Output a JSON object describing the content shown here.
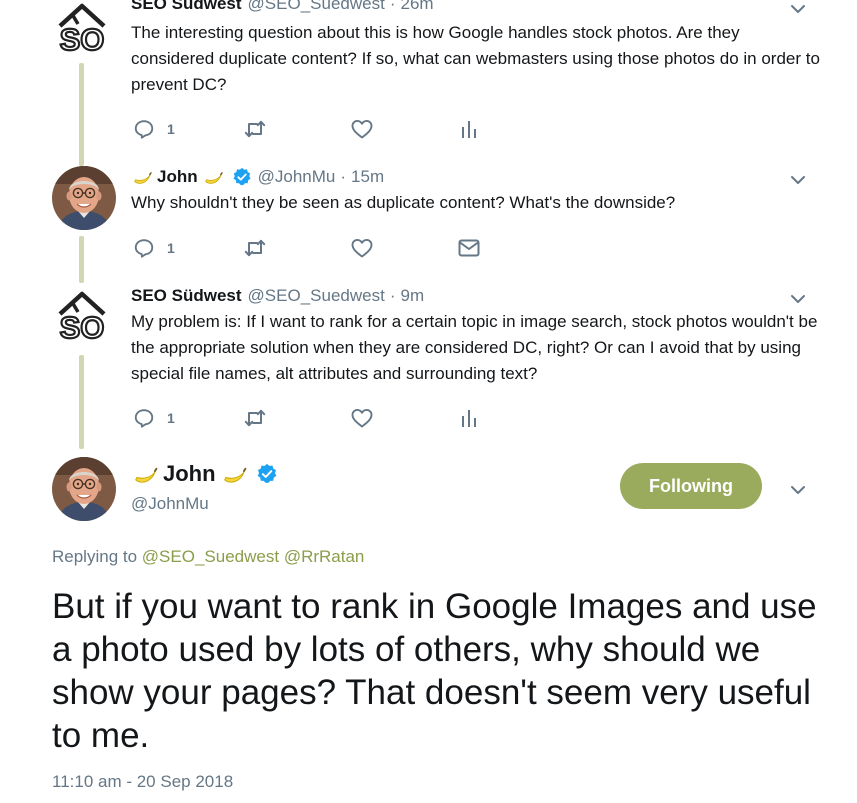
{
  "tweets": [
    {
      "name": "SEO Südwest",
      "handle": "@SEO_Suedwest",
      "dot": "·",
      "time": "26m",
      "text": "The interesting question about this is how Google handles stock photos. Are they considered duplicate content? If so, what can webmasters using those photos do in order to prevent DC?",
      "reply_count": "1"
    },
    {
      "name": "John",
      "handle": "@JohnMu",
      "dot": "·",
      "time": "15m",
      "text": "Why shouldn't they be seen as duplicate content? What's the downside?",
      "reply_count": "1"
    },
    {
      "name": "SEO Südwest",
      "handle": "@SEO_Suedwest",
      "dot": "·",
      "time": "9m",
      "text": "My problem is: If I want to rank for a certain topic in image search, stock photos wouldn't be the appropriate solution when they are considered DC, right? Or can I avoid that by using special file names, alt attributes and surrounding text?",
      "reply_count": "1"
    }
  ],
  "main_tweet": {
    "name": "John",
    "handle": "@JohnMu",
    "follow_label": "Following",
    "replying_prefix": "Replying to",
    "mention_1": "@SEO_Suedwest",
    "mention_2": "@RrRatan",
    "text": "But if you want to rank in Google Images and use a photo used by lots of others, why should we show your pages? That doesn't seem very useful to me.",
    "timestamp": "11:10 am - 20 Sep 2018"
  },
  "colors": {
    "accent": "#9aab5e",
    "thread_line": "#d3d6b3",
    "muted": "#657786",
    "verified": "#1da1f2"
  },
  "icons": [
    "seo-logo-icon",
    "reply-icon",
    "retweet-icon",
    "like-icon",
    "analytics-icon",
    "message-icon",
    "chevron-down-icon",
    "banana-emoji",
    "verified-badge-icon"
  ]
}
